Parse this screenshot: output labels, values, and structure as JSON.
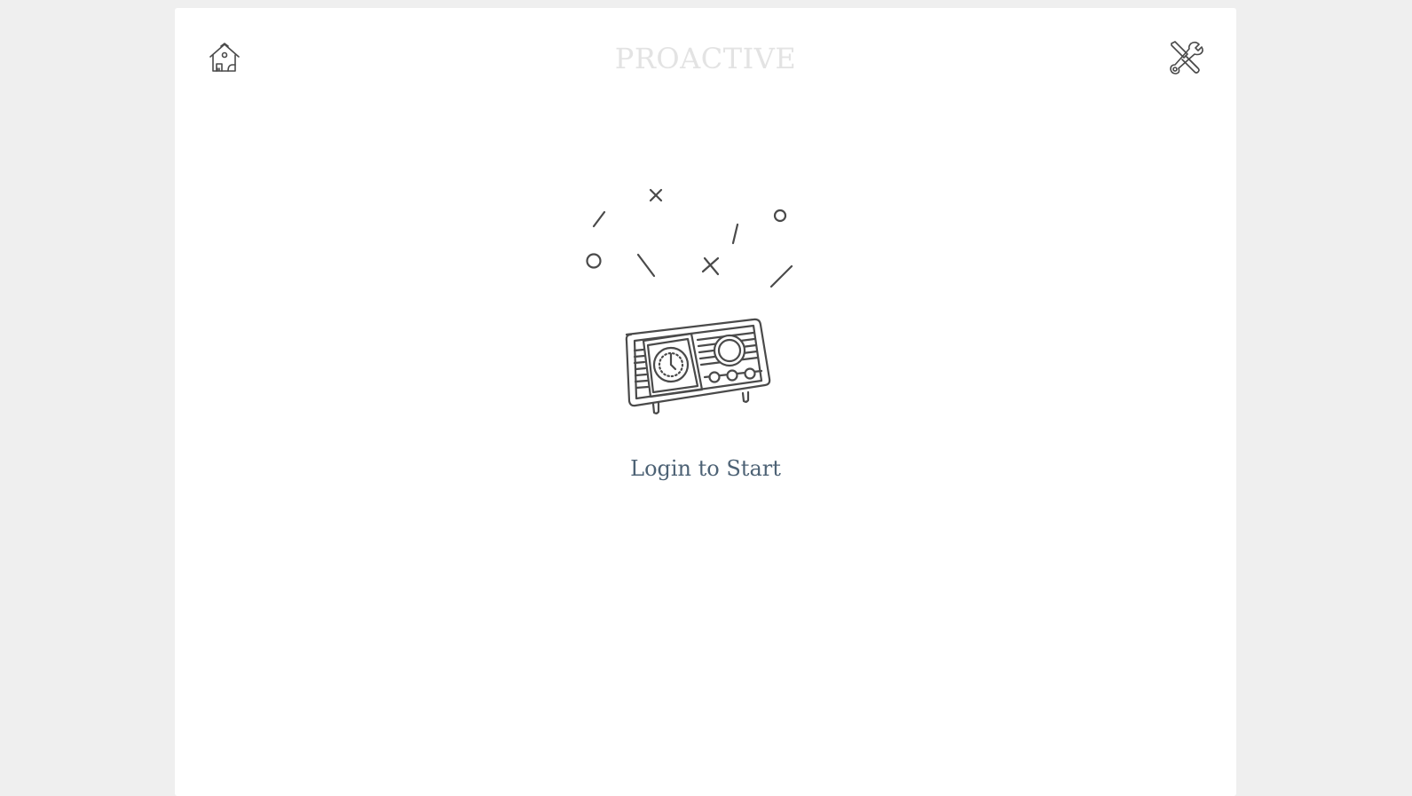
{
  "header": {
    "brand": "PROACTIVE",
    "home_icon": "home-icon",
    "settings_icon": "tools-icon"
  },
  "main": {
    "illustration": "radio-illustration",
    "login_label": "Login to Start"
  },
  "colors": {
    "background": "#efefef",
    "card": "#ffffff",
    "brand_text": "#e3e3e3",
    "link_text": "#4d6275",
    "icon_stroke": "#4a4a4a"
  }
}
